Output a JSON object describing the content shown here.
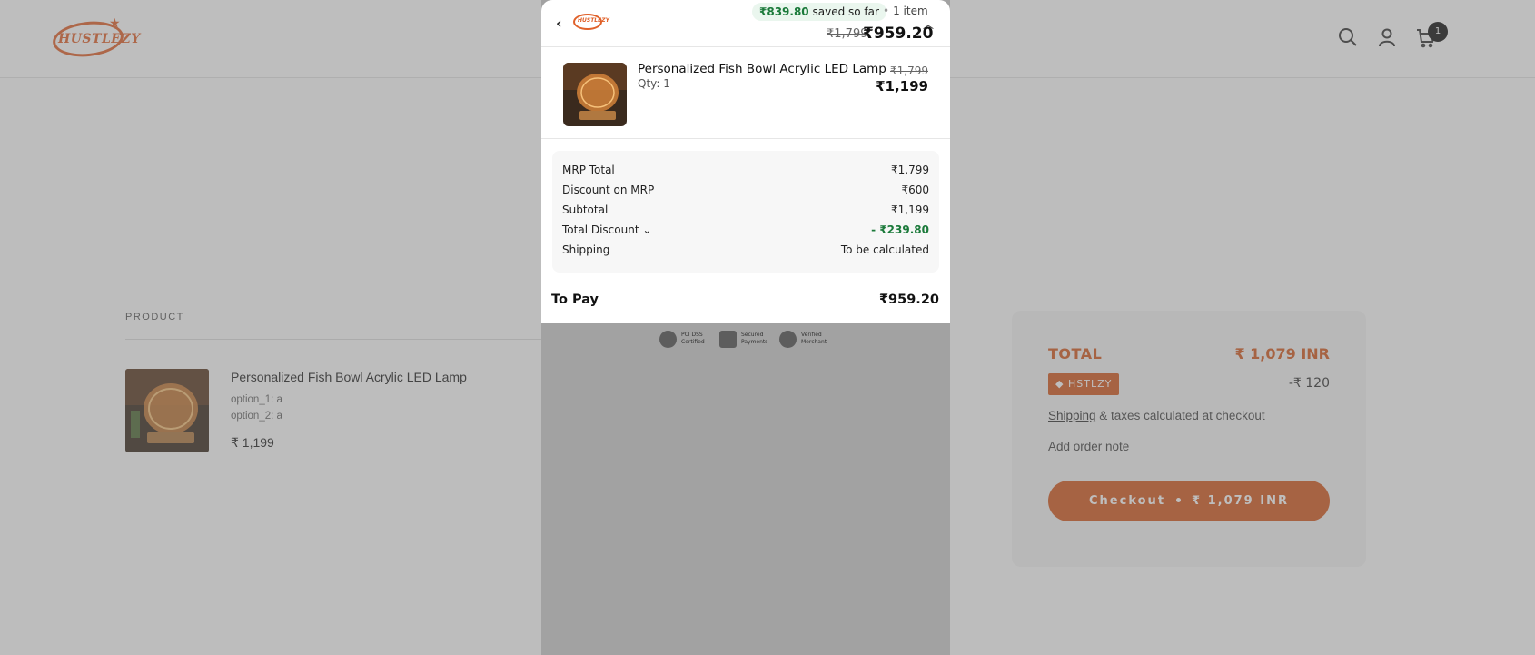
{
  "site": {
    "logo_text": "HUSTLEZY",
    "cart_count": "1"
  },
  "cart": {
    "column_header": "PRODUCT",
    "item": {
      "title": "Personalized Fish Bowl Acrylic LED Lamp",
      "option1": "option_1: a",
      "option2": "option_2: a",
      "price": "₹ 1,199"
    },
    "totals": {
      "label": "TOTAL",
      "value": "₹ 1,079 INR",
      "coupon_code": "HSTLZY",
      "coupon_amount": "-₹ 120",
      "shipping_link": "Shipping",
      "shipping_suffix": " & taxes calculated at checkout",
      "order_note": "Add order note",
      "checkout_label": "Checkout",
      "checkout_amount": "₹ 1,079 INR"
    }
  },
  "modal": {
    "logo_text": "HUSTLEZY",
    "saved_amount": "₹839.80",
    "saved_suffix": "saved so far",
    "item_count": "1 item",
    "original_total": "₹1,799",
    "pay_total": "₹959.20",
    "product": {
      "title": "Personalized Fish Bowl Acrylic LED Lamp",
      "qty": "Qty: 1",
      "mrp": "₹1,799",
      "price": "₹1,199"
    },
    "summary": [
      {
        "label": "MRP Total",
        "value": "₹1,799"
      },
      {
        "label": "Discount on MRP",
        "value": "₹600"
      },
      {
        "label": "Subtotal",
        "value": "₹1,199"
      },
      {
        "label": "Total Discount",
        "value": "- ₹239.80"
      },
      {
        "label": "Shipping",
        "value": "To be calculated"
      }
    ],
    "to_pay_label": "To Pay",
    "to_pay_value": "₹959.20",
    "badges": [
      {
        "line1": "PCI DSS",
        "line2": "Certified"
      },
      {
        "line1": "Secured",
        "line2": "Payments"
      },
      {
        "line1": "Verified",
        "line2": "Merchant"
      }
    ]
  },
  "colors": {
    "brand": "#d45a1f",
    "saved_green": "#1b7a3a"
  }
}
